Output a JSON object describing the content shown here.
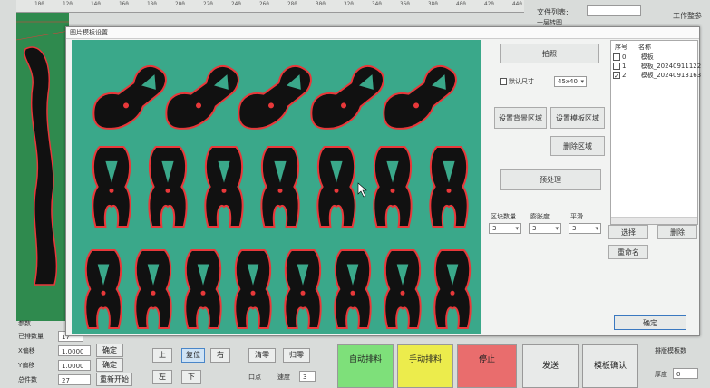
{
  "ruler": {
    "ticks": [
      "100",
      "120",
      "140",
      "160",
      "180",
      "200",
      "220",
      "240",
      "260",
      "280",
      "300",
      "320",
      "340",
      "360",
      "380",
      "400",
      "420",
      "440"
    ]
  },
  "header_right": {
    "file_list_label": "文件列表:",
    "machine_label": "工作整参",
    "sub_label": "一层转图"
  },
  "left_panel": {
    "section_label": "参数",
    "rows": [
      {
        "label": "已排数量",
        "value": "17"
      },
      {
        "label": "X偏移",
        "value": "1.0000",
        "button": "确定"
      },
      {
        "label": "Y偏移",
        "value": "1.0000",
        "button": "确定"
      },
      {
        "label": "总件数",
        "value": "27",
        "button": "重新开始"
      }
    ]
  },
  "toolbar": {
    "row1": [
      "上",
      "复位",
      "右"
    ],
    "row2": [
      "左",
      "下"
    ],
    "clear_label": "清零",
    "reset_label": "归零",
    "point_label": "口点",
    "speed_label": "速度",
    "speed_value": "3"
  },
  "big_buttons": {
    "auto": "自动排料",
    "manual": "手动排料",
    "stop": "停止",
    "send": "发送",
    "project": "模板确认"
  },
  "right_panel": {
    "label": "排版模板数",
    "field_label": "厚度",
    "field_value": "0"
  },
  "dialog": {
    "title": "图片模板设置",
    "capture_button": "拍照",
    "default_size_checkbox": "默认尺寸",
    "default_size_checked": true,
    "size_value": "45x40",
    "set_bg_area": "设置背景区域",
    "set_template_area": "设置模板区域",
    "delete_area": "删除区域",
    "process_image": "预处理",
    "controls": [
      {
        "label": "区块数量",
        "value": "3"
      },
      {
        "label": "膨胀度",
        "value": "3"
      },
      {
        "label": "平滑",
        "value": "3"
      }
    ],
    "select_button": "选择",
    "delete_button": "删除",
    "rename_button": "重命名",
    "confirm_button": "确定",
    "template_list": {
      "headers": [
        "序号",
        "名称"
      ],
      "rows": [
        {
          "index": "0",
          "name": "模板",
          "checked": false
        },
        {
          "index": "1",
          "name": "模板_20240911122",
          "checked": false
        },
        {
          "index": "2",
          "name": "模板_20240913163",
          "checked": true
        }
      ]
    }
  },
  "colors": {
    "camera_bg": "#3aa88a",
    "part_fill": "#111111",
    "part_outline": "#e8383a",
    "auto_btn": "#7ee07a",
    "manual_btn": "#ecec4c",
    "stop_btn": "#e96d6d"
  },
  "camera_parts": {
    "row1_count": 5,
    "row2_count": 7,
    "row3_count": 8
  }
}
